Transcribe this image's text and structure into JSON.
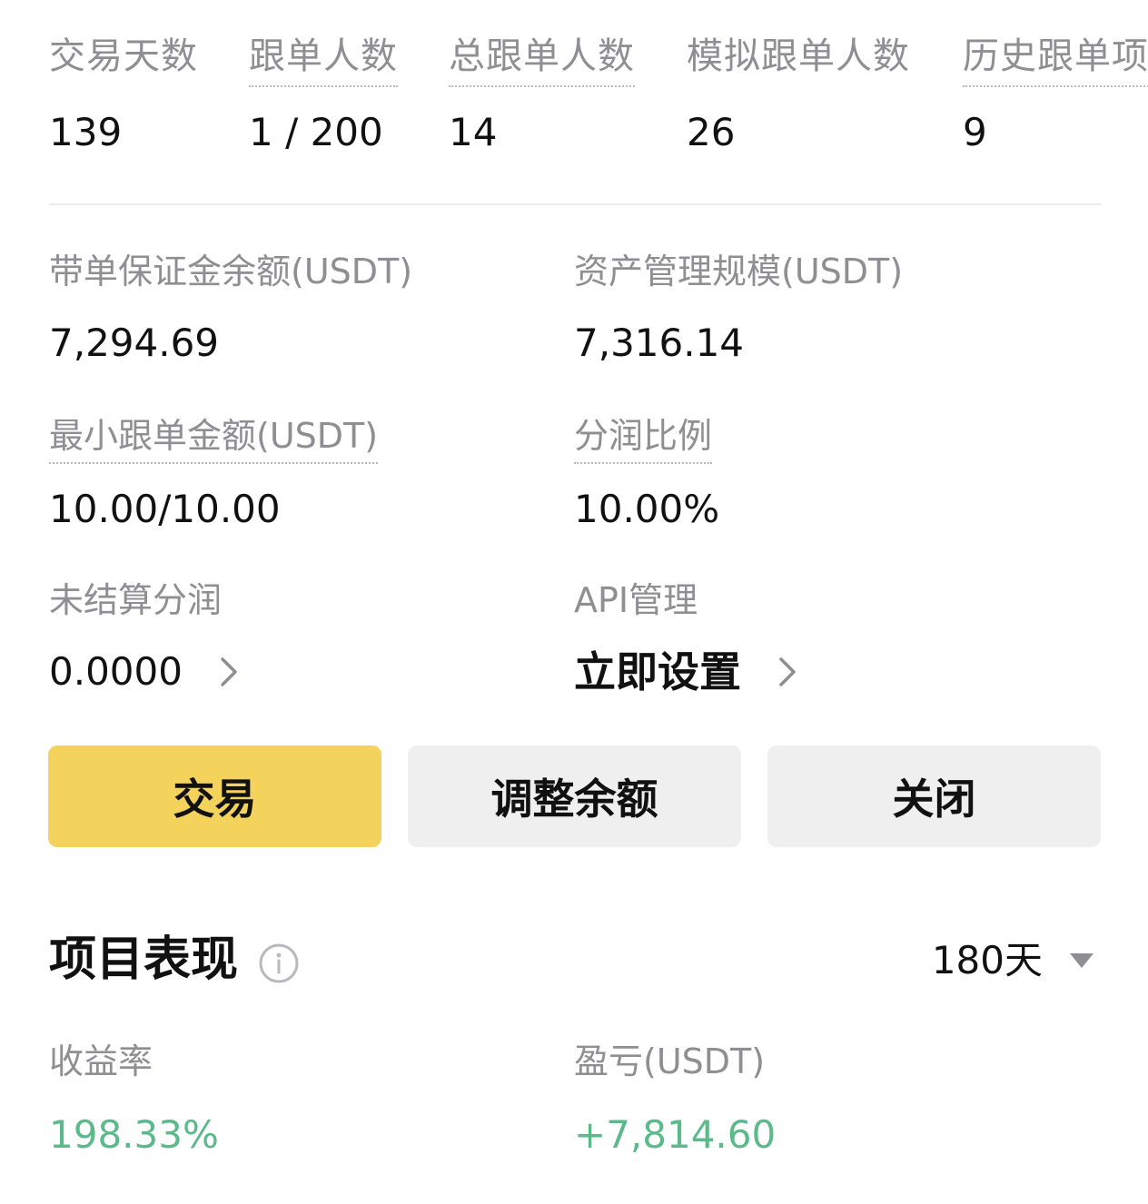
{
  "stats": [
    {
      "label": "交易天数",
      "value": "139"
    },
    {
      "label": "跟单人数",
      "value": "1 / 200"
    },
    {
      "label": "总跟单人数",
      "value": "14"
    },
    {
      "label": "模拟跟单人数",
      "value": "26"
    },
    {
      "label": "历史跟单项",
      "value": "9"
    }
  ],
  "info": {
    "margin_balance": {
      "label": "带单保证金余额(USDT)",
      "value": "7,294.69"
    },
    "aum": {
      "label": "资产管理规模(USDT)",
      "value": "7,316.14"
    },
    "min_copy_amount": {
      "label": "最小跟单金额(USDT)",
      "value": "10.00/10.00"
    },
    "profit_share_ratio": {
      "label": "分润比例",
      "value": "10.00%"
    },
    "unsettled_profit": {
      "label": "未结算分润",
      "value": "0.0000"
    },
    "api_management": {
      "label": "API管理",
      "value": "立即设置"
    }
  },
  "buttons": {
    "trade": "交易",
    "adjust_balance": "调整余额",
    "close": "关闭"
  },
  "performance": {
    "title": "项目表现",
    "period": "180天",
    "roi": {
      "label": "收益率",
      "value": "198.33%"
    },
    "pnl": {
      "label": "盈亏(USDT)",
      "value": "+7,814.60"
    }
  },
  "colors": {
    "accent_yellow": "#f3d35b",
    "positive_green": "#5bb98a",
    "label_gray": "#8e8e93",
    "button_gray": "#efeff0"
  },
  "icons": {
    "chevron": "chevron-right-icon",
    "info": "info-circle-icon",
    "dropdown": "caret-down-icon"
  }
}
